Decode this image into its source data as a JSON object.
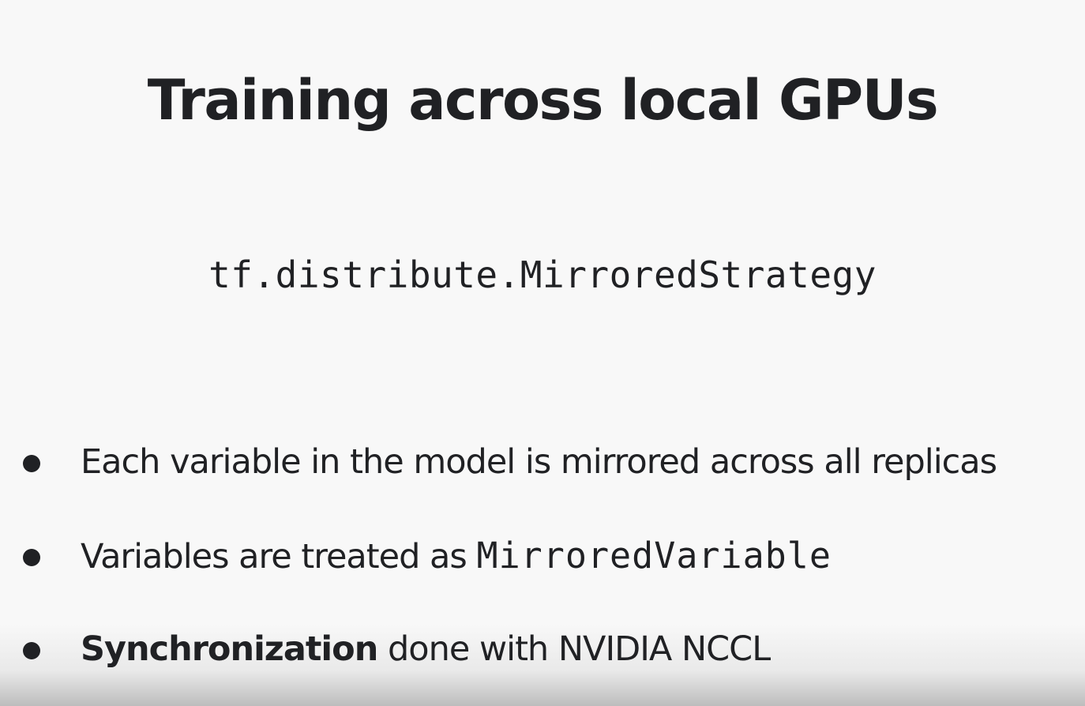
{
  "slide": {
    "title": "Training across local GPUs",
    "code": "tf.distribute.MirroredStrategy",
    "bullets": [
      {
        "text": "Each variable in the model is mirrored across all replicas"
      },
      {
        "prefix": "Variables are treated as ",
        "code": "MirroredVariable"
      },
      {
        "bold": "Synchronization",
        "suffix": " done with NVIDIA NCCL"
      }
    ]
  }
}
